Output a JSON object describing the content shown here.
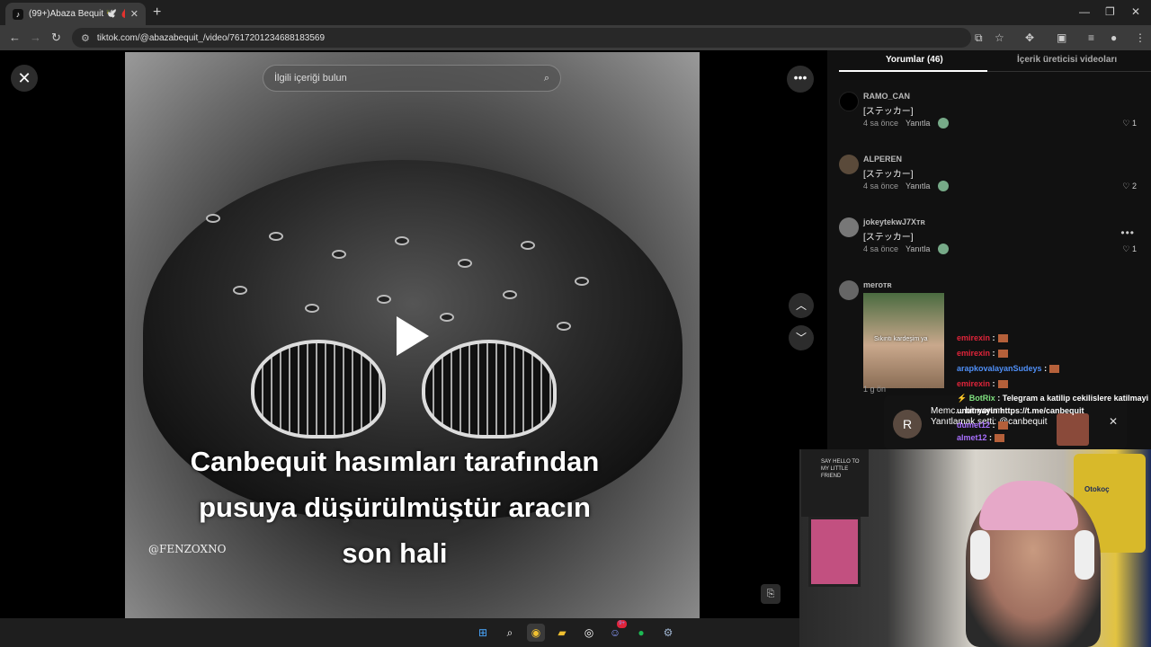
{
  "browser": {
    "tab_title": "(99+)Abaza Bequit 🕊️ 🩸 (@ab",
    "tab_favicon": "tiktok-icon",
    "url": "tiktok.com/@abazabequit_/video/7617201234688183569"
  },
  "video": {
    "search_placeholder": "İlgili içeriği bulun",
    "caption_lines": [
      "Canbequit hasımları tarafından",
      "pusuya düşürülmüştür aracın",
      "son hali"
    ],
    "watermark": "@FENZOXNO"
  },
  "comments_panel": {
    "tabs": [
      {
        "label": "Yorumlar (46)",
        "active": true
      },
      {
        "label": "İçerik üreticisi videoları",
        "active": false
      }
    ],
    "reply_label": "Yanıtla",
    "items": [
      {
        "user": "RAMO_CAN",
        "text": "[ステッカー]",
        "time": "4 sa önce",
        "likes": "1"
      },
      {
        "user": "ALPEREN",
        "text": "[ステッカー]",
        "time": "4 sa önce",
        "likes": "2"
      },
      {
        "user": "jokeytekwJ7Xᴛʀ",
        "text": "[ステッカー]",
        "time": "4 sa önce",
        "likes": "1"
      },
      {
        "user": "meroᴛʀ",
        "sticker_text": "Sıkıntı kardeşim ya",
        "time": "1 g ön"
      }
    ]
  },
  "stream_chat": {
    "lines": [
      {
        "user": "emirexin",
        "sep": ":",
        "color": "#e0243a"
      },
      {
        "user": "emirexin",
        "sep": ":",
        "color": "#e0243a"
      },
      {
        "user": "arapkovalayanSudeys",
        "sep": ":",
        "color": "#4f8ff7"
      },
      {
        "user": "emirexin",
        "sep": ":",
        "color": "#e0243a"
      }
    ],
    "bot_user": "BotRix",
    "bot_message": ": Telegram a katilip cekilislere katilmayi unutmayin https://t.me/canbequit",
    "tail_lines": [
      {
        "user": "dumet12",
        "sep": ":"
      },
      {
        "user": "almet12",
        "sep": ":"
      }
    ],
    "tail_color": "#a970ff"
  },
  "notification": {
    "avatar_letter": "R",
    "text": "Memc... bir yorum... Yanıtlamak setti: @canbequit"
  },
  "webcam": {
    "shirt_text": "SAY HELLO TO MY LITTLE FRIEND",
    "jersey_text": "Otokoç"
  },
  "taskbar": {
    "icons": [
      "windows-start-icon",
      "search-icon",
      "chrome-icon",
      "file-explorer-icon",
      "obs-icon",
      "discord-icon",
      "spotify-icon",
      "settings-icon"
    ],
    "discord_badge": "9+"
  }
}
